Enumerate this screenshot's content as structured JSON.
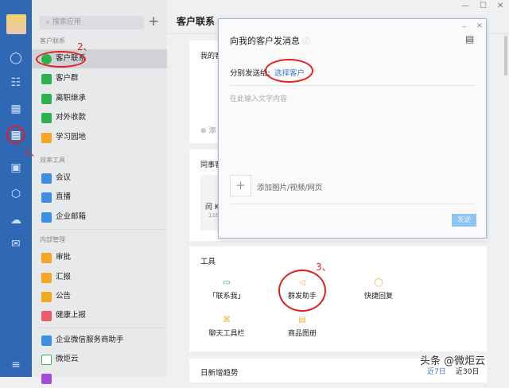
{
  "rail": {
    "icons": [
      "chat-icon",
      "org-chart-icon",
      "calendar-icon",
      "apps-icon",
      "doc-icon",
      "drive-icon",
      "cloud-icon",
      "mail-icon",
      "menu-icon"
    ]
  },
  "sidebar": {
    "search_placeholder": "搜索应用",
    "sections": [
      {
        "label": "客户联系",
        "items": [
          "客户联系",
          "客户群",
          "离职继承",
          "对外收款",
          "学习园地"
        ]
      },
      {
        "label": "效率工具",
        "items": [
          "会议",
          "直播",
          "企业邮箱"
        ]
      },
      {
        "label": "内部管理",
        "items": [
          "审批",
          "汇报",
          "公告",
          "健康上报"
        ]
      },
      {
        "label": "",
        "items": [
          "企业微信服务商助手",
          "微炬云"
        ]
      }
    ]
  },
  "main": {
    "title": "客户联系",
    "card1_label": "我的客",
    "add_label": "添",
    "card2_label": "同事客",
    "colleague_name": "闫 K",
    "colleague_num": "118",
    "tools_title": "工具",
    "tools": [
      "「联系我」",
      "群发助手",
      "快捷回复",
      "聊天工具栏",
      "商品图册"
    ],
    "trend_title": "日新增趋势",
    "range_7": "近7日",
    "range_30": "近30日"
  },
  "modal": {
    "title": "向我的客户发消息",
    "send_to_label": "分别发送给:",
    "select_customer": "选择客户",
    "text_placeholder": "在此输入文字内容",
    "add_media": "添加图片/视频/网页",
    "send_button": "发送"
  },
  "annotations": {
    "step1": "1、",
    "step2": "2、",
    "step3": "3、"
  },
  "watermark": "头条 @微炬云",
  "colors": {
    "rail": "#2f68b4",
    "accent": "#3a7bd5",
    "annotation": "#e02020"
  }
}
